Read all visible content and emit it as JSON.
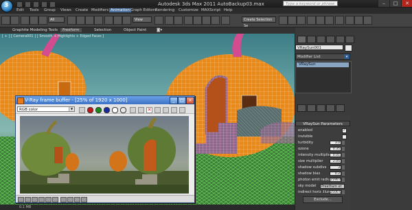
{
  "app": {
    "title": "Autodesk 3ds Max 2011     AutoBackup03.max",
    "search_placeholder": "Type a keyword or phrase"
  },
  "menu": [
    "Edit",
    "Tools",
    "Group",
    "Views",
    "Create",
    "Modifiers",
    "Animation",
    "Graph Editors",
    "Rendering",
    "Customize",
    "MAXScript",
    "Help"
  ],
  "toolbar": {
    "selection_filter": "All",
    "reference_coord": "View",
    "named_selection": "Create Selection Se"
  },
  "ribbon": {
    "tabs": [
      "Graphite Modeling Tools",
      "Freeform",
      "Selection",
      "Object Paint"
    ]
  },
  "viewport": {
    "label": "[ + ] [ Camera001 ] [ Smooth + Highlights + Edged Faces ]"
  },
  "command_panel": {
    "object_name": "VRaySun001",
    "modifier_list": "Modifier List",
    "stack_item": "VRaySun",
    "rollout_title": "VRaySun Parameters",
    "params": [
      {
        "label": "enabled",
        "value": "",
        "check": "✓"
      },
      {
        "label": "invisible",
        "value": "",
        "check": ""
      },
      {
        "label": "turbidity",
        "value": "3.0"
      },
      {
        "label": "ozone",
        "value": "0.35"
      },
      {
        "label": "intensity multiplier",
        "value": "0.01"
      },
      {
        "label": "size multiplier",
        "value": "2.05"
      },
      {
        "label": "shadow subdivs",
        "value": "3"
      },
      {
        "label": "shadow bias",
        "value": "0.2"
      },
      {
        "label": "photon emit radius",
        "value": "2190.4"
      }
    ],
    "sky_model_label": "sky model",
    "sky_model_value": "Preetham et al.",
    "indirect_label": "indirect horiz illum",
    "indirect_value": "2500.0",
    "exclude_label": "Exclude..."
  },
  "vfb": {
    "title": "V-Ray frame buffer - [25% of 1920 x 1000]",
    "channel": "RGB color"
  },
  "colors": {
    "accent": "#4a6f9c",
    "pumpkin": "#e8891a",
    "wire_green": "#7dff6a",
    "wire_pink": "#ff9ad8"
  },
  "status": {
    "text": "0.1 MB"
  }
}
